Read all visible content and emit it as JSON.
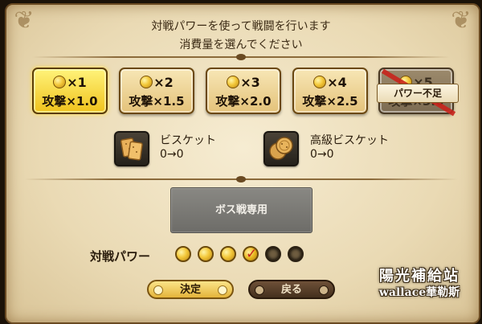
{
  "instructions": {
    "line1": "対戦パワーを使って戦闘を行います",
    "line2": "消費量を選んでください"
  },
  "options": [
    {
      "line1": "×1",
      "line2": "攻撃×1.0",
      "state": "selected"
    },
    {
      "line1": "×2",
      "line2": "攻撃×1.5",
      "state": "normal"
    },
    {
      "line1": "×3",
      "line2": "攻撃×2.0",
      "state": "normal"
    },
    {
      "line1": "×4",
      "line2": "攻撃×2.5",
      "state": "normal"
    },
    {
      "line1": "×5",
      "line2": "攻撃×3.0",
      "state": "disabled",
      "badge": "パワー不足"
    }
  ],
  "items": [
    {
      "name": "ビスケット",
      "count": "0→0",
      "icon": "biscuit-icon"
    },
    {
      "name": "高級ビスケット",
      "count": "0→0",
      "icon": "premium-biscuit-icon"
    }
  ],
  "boss_button": {
    "label": "ボス戦専用"
  },
  "power": {
    "label": "対戦パワー",
    "max": 6,
    "current": 4,
    "spend": 1
  },
  "buttons": {
    "confirm": "決定",
    "back": "戻る"
  },
  "watermark": {
    "line1": "陽光補給站",
    "line2": "wallace華勒斯"
  },
  "colors": {
    "selected": "#f0c21c",
    "disabled": "#7c6b52",
    "strike": "#c8241c"
  }
}
